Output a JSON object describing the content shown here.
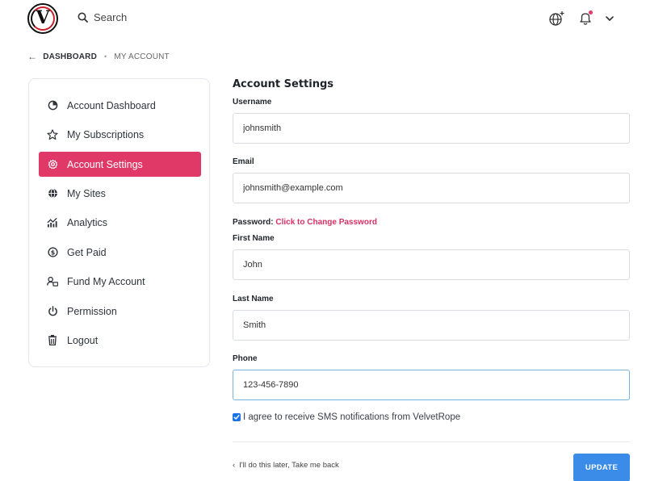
{
  "header": {
    "search_label": "Search",
    "icons": [
      "logo",
      "search-icon",
      "globe-add-icon",
      "bell-icon",
      "chevron-down-icon"
    ],
    "notification_dot_color": "#e53a66"
  },
  "breadcrumb": {
    "items": [
      "DASHBOARD",
      "MY ACCOUNT"
    ]
  },
  "sidebar": {
    "items": [
      {
        "label": "Account Dashboard",
        "icon": "pie-chart-icon",
        "active": false
      },
      {
        "label": "My Subscriptions",
        "icon": "star-icon",
        "active": false
      },
      {
        "label": "Account Settings",
        "icon": "gear-icon",
        "active": true
      },
      {
        "label": "My Sites",
        "icon": "globe-icon",
        "active": false
      },
      {
        "label": "Analytics",
        "icon": "analytics-icon",
        "active": false
      },
      {
        "label": "Get Paid",
        "icon": "dollar-icon",
        "active": false
      },
      {
        "label": "Fund My Account",
        "icon": "fund-icon",
        "active": false
      },
      {
        "label": "Permission",
        "icon": "power-icon",
        "active": false
      },
      {
        "label": "Logout",
        "icon": "trash-icon",
        "active": false
      }
    ],
    "active_color": "#e03968"
  },
  "form": {
    "title": "Account Settings",
    "username_label": "Username",
    "username_value": "johnsmith",
    "email_label": "Email",
    "email_value": "johnsmith@example.com",
    "password_label": "Password:",
    "password_link": "Click to Change Password",
    "first_name_label": "First Name",
    "first_name_value": "John",
    "last_name_label": "Last Name",
    "last_name_value": "Smith",
    "phone_label": "Phone",
    "phone_value": "123-456-7890",
    "sms_consent_label": "I agree to receive SMS notifications from VelvetRope",
    "sms_consent_checked": true,
    "back_link": "I'll do this later, Take me back",
    "update_label": "UPDATE"
  },
  "colors": {
    "accent_pink": "#e03968",
    "link_pink": "#d63063",
    "primary_blue": "#3a8ce8"
  }
}
